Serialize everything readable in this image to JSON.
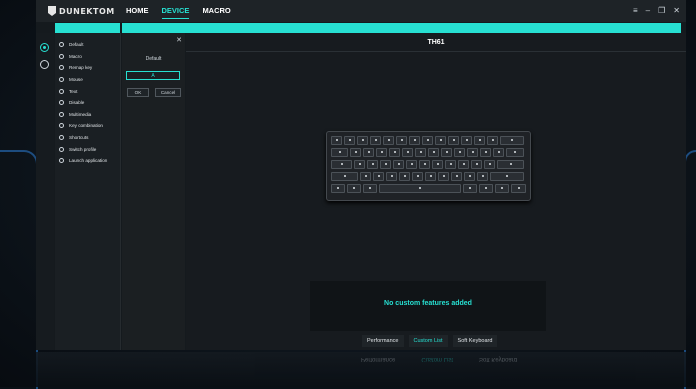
{
  "app": {
    "brand": "DUNEKTOM",
    "nav": [
      {
        "label": "HOME"
      },
      {
        "label": "DEVICE"
      },
      {
        "label": "MACRO"
      }
    ],
    "window_controls": {
      "menu": "≡",
      "minimize": "–",
      "restore": "❐",
      "close": "✕"
    }
  },
  "functions": [
    {
      "label": "Default",
      "icon": "default-icon"
    },
    {
      "label": "Macro",
      "icon": "macro-icon"
    },
    {
      "label": "Remap key",
      "icon": "remap-icon"
    },
    {
      "label": "Mouse",
      "icon": "mouse-icon"
    },
    {
      "label": "Text",
      "icon": "text-icon"
    },
    {
      "label": "Disable",
      "icon": "disable-icon"
    },
    {
      "label": "Multimedia",
      "icon": "multimedia-icon"
    },
    {
      "label": "Key combination",
      "icon": "key-combination-icon"
    },
    {
      "label": "Shortcuts",
      "icon": "shortcuts-icon"
    },
    {
      "label": "Switch profile",
      "icon": "switch-profile-icon"
    },
    {
      "label": "Launch application",
      "icon": "launch-icon"
    }
  ],
  "editor": {
    "close": "✕",
    "label": "Default",
    "key_value": "A",
    "ok": "OK",
    "cancel": "Cancel"
  },
  "device": {
    "title": "TH61",
    "message": "No custom features added"
  },
  "tabs": [
    {
      "label": "Performance",
      "active": false
    },
    {
      "label": "Custom List",
      "active": true
    },
    {
      "label": "Soft Keyboard",
      "active": false
    }
  ],
  "colors": {
    "accent": "#27e0d2",
    "background": "#151a1e"
  }
}
